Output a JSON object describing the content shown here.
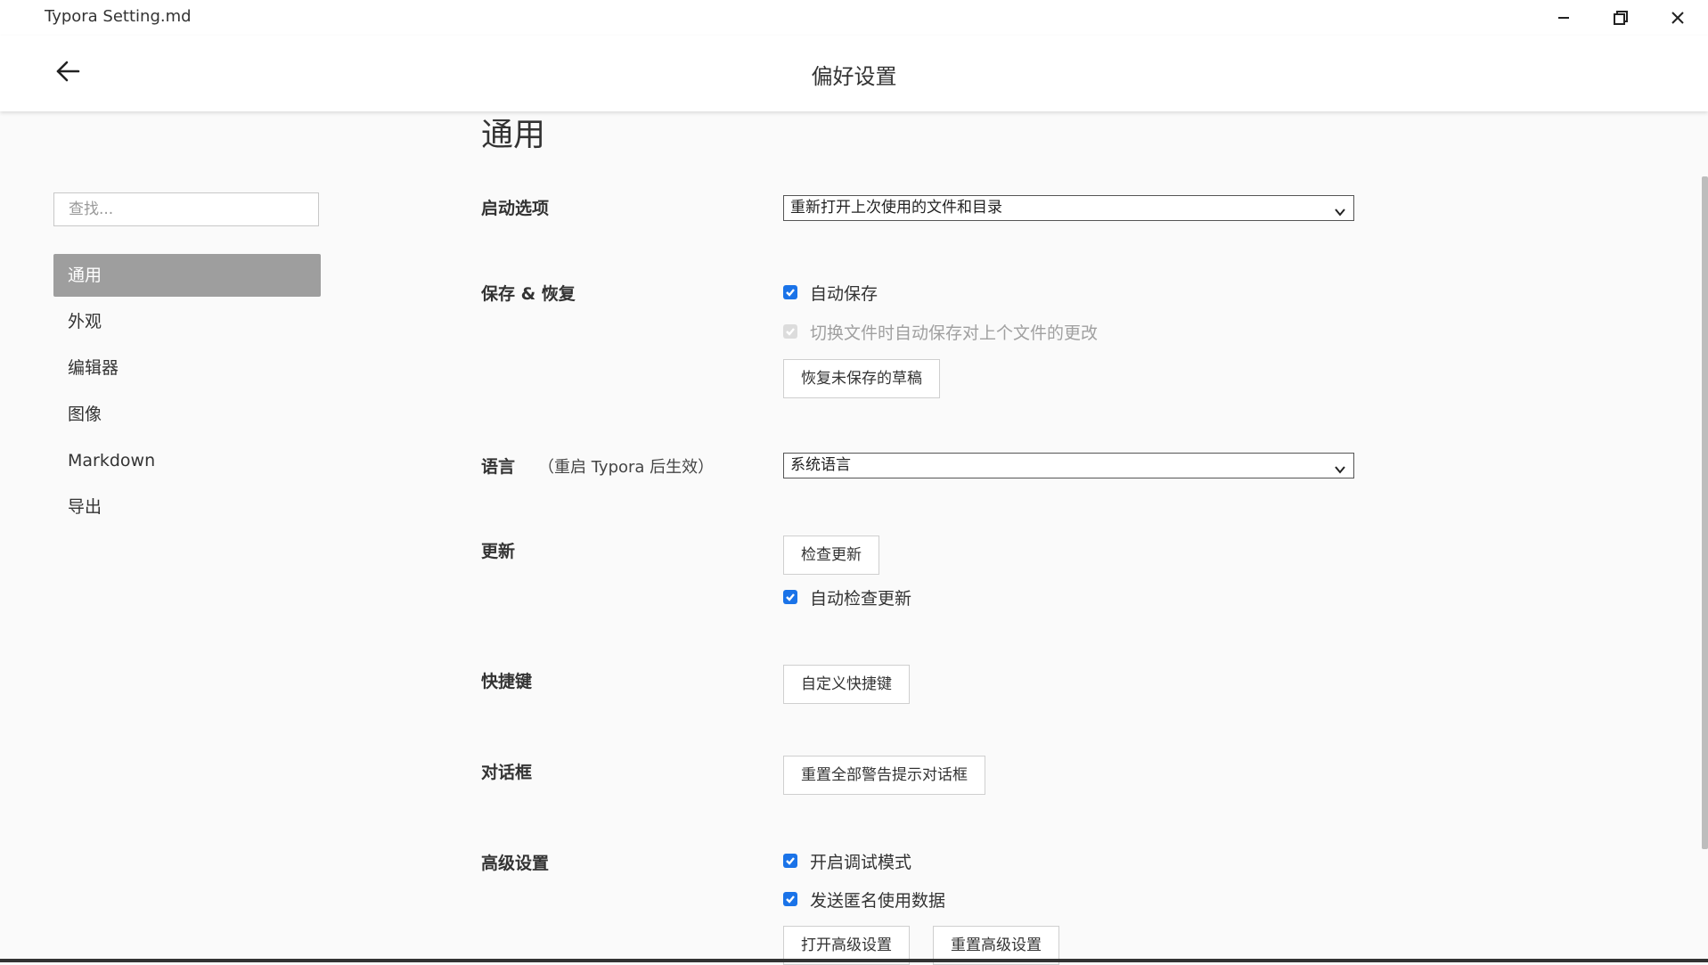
{
  "window": {
    "title": "Typora Setting.md",
    "controls": {
      "minimize": "minimize-icon",
      "maximize": "restore-icon",
      "close": "close-icon"
    }
  },
  "header": {
    "title": "偏好设置",
    "back_icon": "arrow-left-icon"
  },
  "sidebar": {
    "search_placeholder": "查找...",
    "items": [
      {
        "label": "通用",
        "active": true
      },
      {
        "label": "外观"
      },
      {
        "label": "编辑器"
      },
      {
        "label": "图像"
      },
      {
        "label": "Markdown"
      },
      {
        "label": "导出"
      }
    ]
  },
  "content": {
    "section_title": "通用",
    "startup": {
      "label": "启动选项",
      "selected": "重新打开上次使用的文件和目录"
    },
    "save": {
      "label": "保存 & 恢复",
      "autosave": {
        "label": "自动保存",
        "checked": true
      },
      "switch_save": {
        "label": "切换文件时自动保存对上个文件的更改",
        "checked": true,
        "disabled": true
      },
      "recover_button": "恢复未保存的草稿"
    },
    "language": {
      "label": "语言",
      "note": "（重启 Typora 后生效）",
      "selected": "系统语言"
    },
    "update": {
      "label": "更新",
      "check_button": "检查更新",
      "auto_check": {
        "label": "自动检查更新",
        "checked": true
      }
    },
    "shortcut": {
      "label": "快捷键",
      "button": "自定义快捷键"
    },
    "dialog": {
      "label": "对话框",
      "button": "重置全部警告提示对话框"
    },
    "advanced": {
      "label": "高级设置",
      "debug": {
        "label": "开启调试模式",
        "checked": true
      },
      "anonymous": {
        "label": "发送匿名使用数据",
        "checked": true
      },
      "open_button": "打开高级设置",
      "reset_button": "重置高级设置"
    }
  },
  "colors": {
    "accent": "#1a73e8",
    "active_nav_bg": "#9e9e9e",
    "background": "#fafafa"
  }
}
